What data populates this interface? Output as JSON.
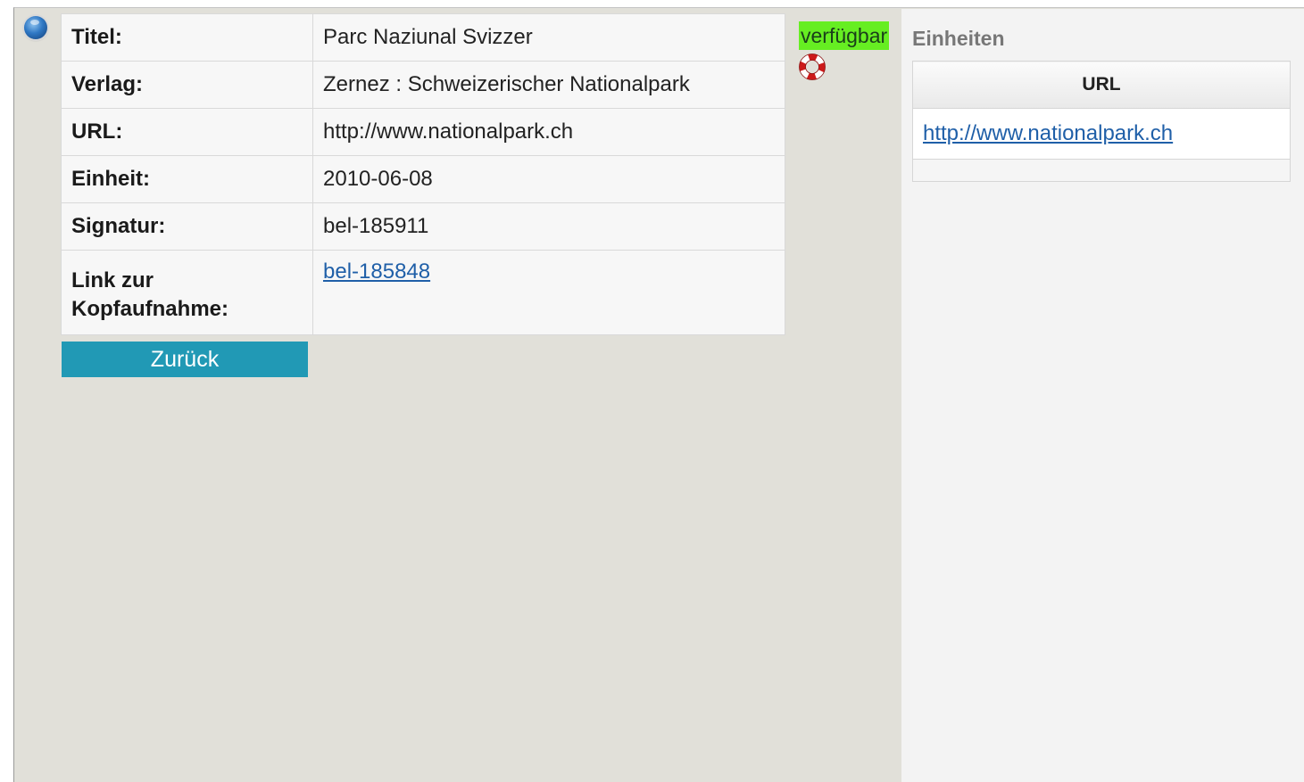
{
  "record": {
    "rows": [
      {
        "label": "Titel:",
        "value": "Parc Naziunal Svizzer"
      },
      {
        "label": "Verlag:",
        "value": "Zernez : Schweizerischer Nationalpark"
      },
      {
        "label": "URL:",
        "value": "http://www.nationalpark.ch"
      },
      {
        "label": "Einheit:",
        "value": "2010-06-08"
      },
      {
        "label": "Signatur:",
        "value": "bel-185911"
      }
    ],
    "head_record": {
      "label_line1": "Link zur",
      "label_line2": "Kopfaufnahme:",
      "link": "bel-185848"
    },
    "back_button": "Zurück"
  },
  "status": {
    "label": "verfügbar",
    "color": "#66ee22"
  },
  "units_panel": {
    "title": "Einheiten",
    "column": "URL",
    "url": "http://www.nationalpark.ch"
  },
  "icons": [
    "info-icon",
    "lifebuoy-help-icon"
  ],
  "colors": {
    "button": "#2199b5",
    "link": "#1f5fa8",
    "background": "#e1e0d9"
  }
}
